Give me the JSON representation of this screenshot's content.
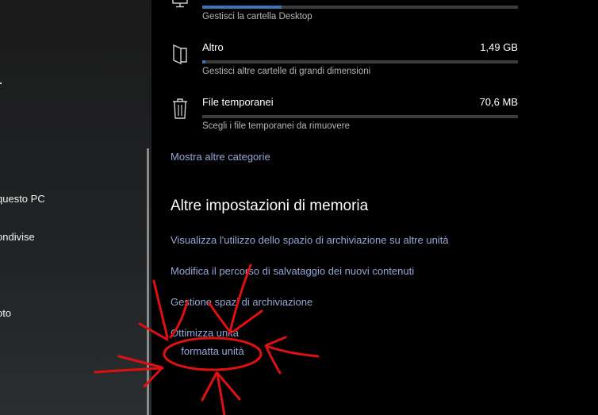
{
  "sidebar": {
    "items": [
      {
        "label": "questo PC"
      },
      {
        "label": "ondivise"
      },
      {
        "label": "oto"
      }
    ]
  },
  "categories": [
    {
      "name": "",
      "size": "",
      "fill": 0.25,
      "description": "Gestisci la cartella Desktop",
      "icon": "monitor-icon"
    },
    {
      "name": "Altro",
      "size": "1,49 GB",
      "fill": 0.01,
      "description": "Gestisci altre cartelle di grandi dimensioni",
      "icon": "folder-icon"
    },
    {
      "name": "File temporanei",
      "size": "70,6 MB",
      "fill": 0.0,
      "description": "Scegli i file temporanei da rimuovere",
      "icon": "trash-icon"
    }
  ],
  "show_more": "Mostra altre categorie",
  "section_title": "Altre impostazioni di memoria",
  "links": [
    "Visualizza l'utilizzo dello spazio di archiviazione su altre unità",
    "Modifica il percorso di salvataggio dei nuovi contenuti",
    "Gestione spazi di archiviazione",
    "Ottimizza unità"
  ],
  "annotation": {
    "text": "formatta unità",
    "color": "#e01010"
  },
  "colors": {
    "accent": "#3d72b8",
    "link": "#97a7d8"
  }
}
